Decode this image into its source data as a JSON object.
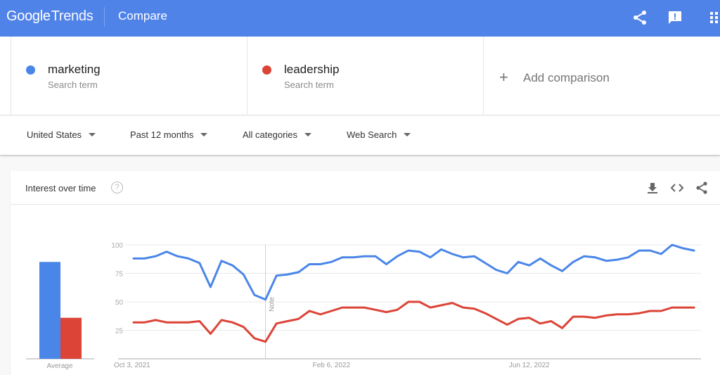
{
  "header": {
    "logo_google": "Google",
    "logo_trends": "Trends",
    "page_title": "Compare",
    "icons": [
      "share-icon",
      "feedback-icon",
      "apps-grid-icon"
    ],
    "brand_color": "#5083e8"
  },
  "terms": [
    {
      "name": "marketing",
      "subtitle": "Search term",
      "color": "#4a86e8"
    },
    {
      "name": "leadership",
      "subtitle": "Search term",
      "color": "#db4437"
    }
  ],
  "add_comparison": {
    "icon": "+",
    "label": "Add comparison"
  },
  "filters": [
    {
      "label": "United States"
    },
    {
      "label": "Past 12 months"
    },
    {
      "label": "All categories"
    },
    {
      "label": "Web Search"
    }
  ],
  "card": {
    "title": "Interest over time",
    "help_icon": "?",
    "actions": [
      "download-icon",
      "embed-icon",
      "share-icon"
    ]
  },
  "chart_data": {
    "type": "line",
    "title": "Interest over time",
    "xlabel": "",
    "ylabel": "",
    "ylim": [
      0,
      100
    ],
    "y_ticks": [
      25,
      50,
      75,
      100
    ],
    "x_tick_labels": [
      {
        "index": 0,
        "label": "Oct 3, 2021"
      },
      {
        "index": 18,
        "label": "Feb 6, 2022"
      },
      {
        "index": 36,
        "label": "Jun 12, 2022"
      }
    ],
    "grid": true,
    "note": {
      "index": 12,
      "label": "Note"
    },
    "series": [
      {
        "name": "marketing",
        "color": "#4a86e8",
        "average": 85,
        "values": [
          88,
          88,
          90,
          94,
          90,
          88,
          84,
          63,
          86,
          82,
          74,
          56,
          52,
          73,
          74,
          76,
          83,
          83,
          85,
          89,
          89,
          90,
          90,
          83,
          90,
          95,
          94,
          89,
          96,
          92,
          89,
          90,
          84,
          78,
          75,
          85,
          82,
          88,
          82,
          77,
          85,
          90,
          89,
          86,
          87,
          89,
          95,
          95,
          92,
          100,
          97,
          95
        ]
      },
      {
        "name": "leadership",
        "color": "#db4437",
        "average": 36,
        "values": [
          32,
          32,
          34,
          32,
          32,
          32,
          33,
          22,
          34,
          32,
          28,
          18,
          15,
          31,
          33,
          35,
          42,
          39,
          42,
          45,
          45,
          45,
          43,
          41,
          43,
          50,
          50,
          45,
          47,
          49,
          45,
          44,
          40,
          35,
          30,
          35,
          36,
          31,
          33,
          27,
          37,
          37,
          36,
          38,
          39,
          39,
          40,
          42,
          42,
          45,
          45,
          45
        ]
      }
    ],
    "average_label": "Average"
  }
}
